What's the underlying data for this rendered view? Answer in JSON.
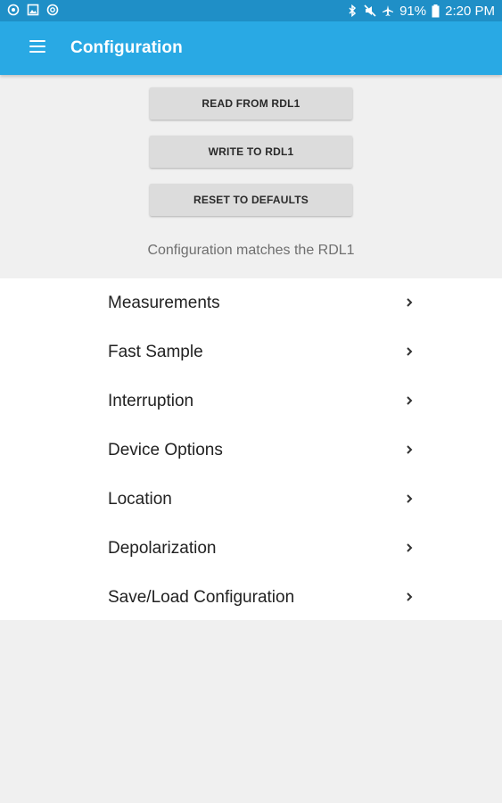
{
  "status_bar": {
    "battery": "91%",
    "time": "2:20 PM",
    "left_icons": [
      "notification-icon",
      "image-icon",
      "settings-icon"
    ],
    "right_icons": [
      "bluetooth-icon",
      "mute-icon",
      "airplane-icon",
      "battery-icon"
    ]
  },
  "app_bar": {
    "title": "Configuration",
    "color": "#29a9e4"
  },
  "actions": {
    "read": "READ FROM RDL1",
    "write": "WRITE TO RDL1",
    "reset": "RESET TO DEFAULTS"
  },
  "status_message": "Configuration matches the RDL1",
  "menu": {
    "items": [
      {
        "label": "Measurements"
      },
      {
        "label": "Fast Sample"
      },
      {
        "label": "Interruption"
      },
      {
        "label": "Device Options"
      },
      {
        "label": "Location"
      },
      {
        "label": "Depolarization"
      },
      {
        "label": "Save/Load Configuration"
      }
    ]
  }
}
